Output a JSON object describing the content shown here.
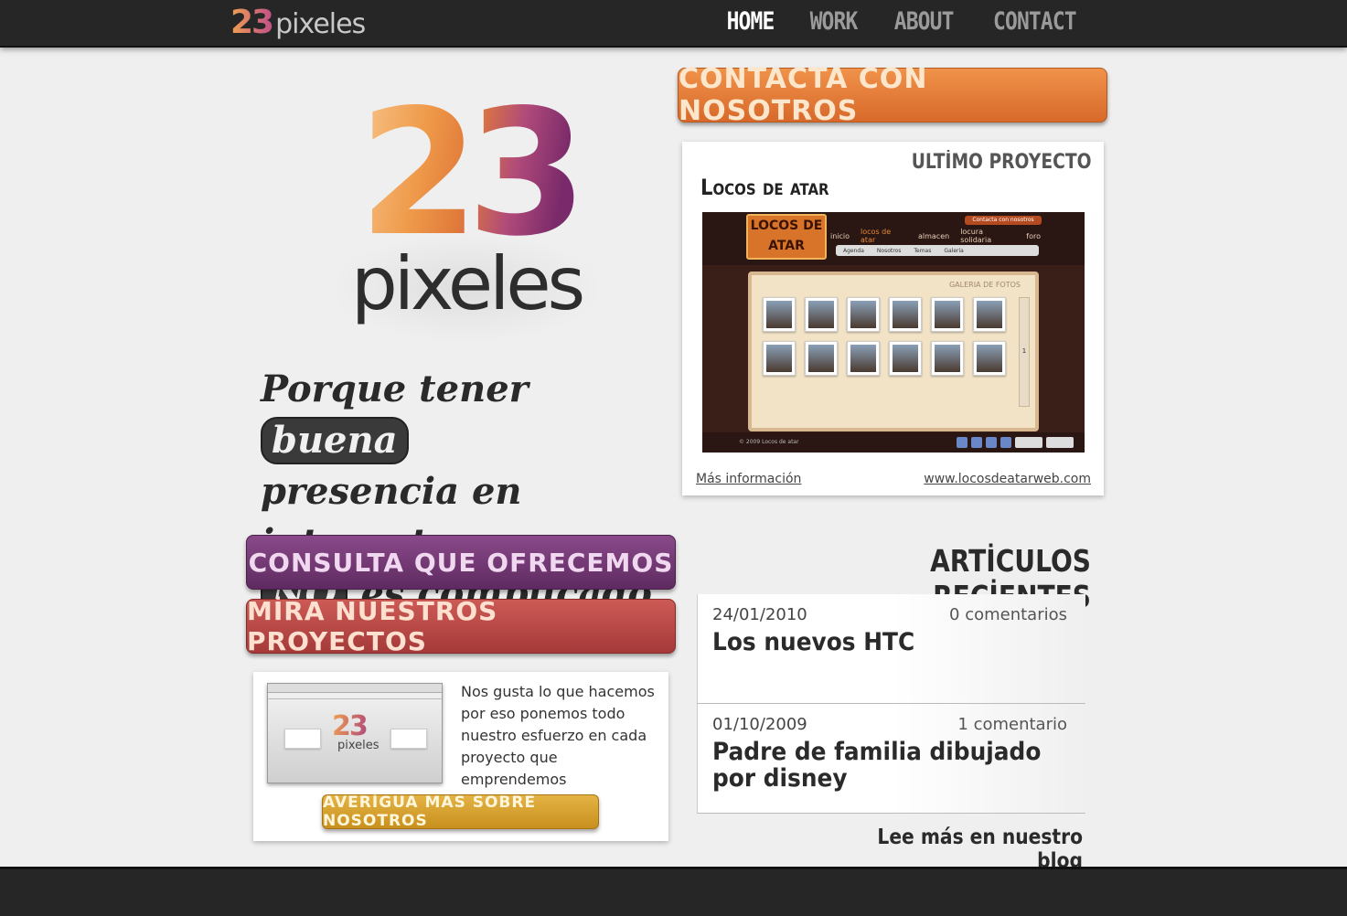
{
  "header": {
    "logo_number": "23",
    "logo_word": "pixeles",
    "nav": [
      {
        "label": "HOME",
        "active": true
      },
      {
        "label": "WORK",
        "active": false
      },
      {
        "label": "ABOUT",
        "active": false
      },
      {
        "label": "CONTACT",
        "active": false
      }
    ]
  },
  "hero": {
    "logo_number": "23",
    "logo_word": "pixeles",
    "tagline": {
      "part1": "Porque tener",
      "highlight1": "buena",
      "part2": "presencia en internet",
      "highlight2": "NO",
      "part3": "es complicado."
    }
  },
  "buttons": {
    "contact": "CONTACTA CON NOSOTROS",
    "consulta": "CONSULTA QUE OFRECEMOS",
    "mira": "MİRA NUESTROS PROYECTOS",
    "averigua": "AVERİGUA MAS SOBRE NOSOTROS"
  },
  "latest_project": {
    "heading": "ULTİMO PROYECTO",
    "name": "Locos de atar",
    "more_link": "Más información",
    "site_link": "www.locosdeatarweb.com",
    "screenshot": {
      "logo": "LOCOS DE ATAR",
      "contact_btn": "Contacta con nosotros",
      "menu": [
        "inicio",
        "locos de atar",
        "almacen",
        "locura solidaria",
        "foro"
      ],
      "submenu": [
        "Agenda",
        "Nosotros",
        "Temas",
        "Galeria"
      ],
      "gallery_title": "GALERIA DE FOTOS",
      "page_number": "1",
      "footer": "© 2009 Locos de atar"
    }
  },
  "about": {
    "text": "Nos gusta lo que hacemos por eso ponemos todo nuestro esfuerzo en cada proyecto que emprendemos",
    "shot_logo_number": "23",
    "shot_logo_word": "pixeles"
  },
  "articles": {
    "heading": "ARTİCULOS RECİENTES",
    "items": [
      {
        "date": "24/01/2010",
        "comments": "0 comentarios",
        "title": "Los nuevos HTC"
      },
      {
        "date": "01/10/2009",
        "comments": "1 comentario",
        "title": "Padre de familia dibujado por disney"
      }
    ],
    "blog_link": "Lee más en nuestro blog"
  },
  "colors": {
    "topbar": "#262626",
    "contact_button": "#e0783a",
    "consulta_button": "#6e366f",
    "mira_button": "#b44a47",
    "averigua_button": "#d6a02e"
  }
}
